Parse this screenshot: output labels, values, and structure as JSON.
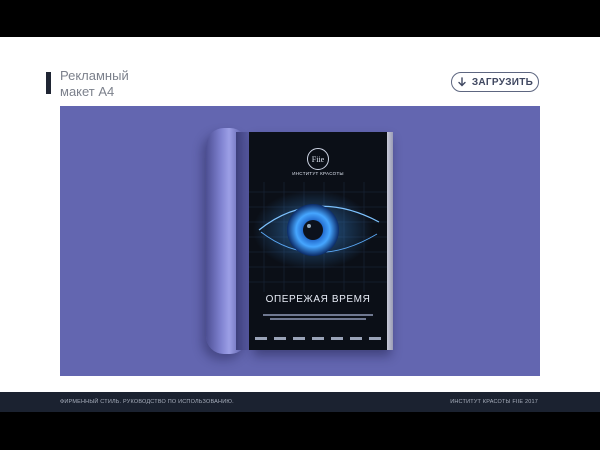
{
  "header": {
    "title": "Рекламный\nмакет А4",
    "download_label": "ЗАГРУЗИТЬ",
    "download_icon": "download-arrow-icon"
  },
  "colors": {
    "stage_background": "#6366b0",
    "footer_background": "#1b2230",
    "accent_dark": "#1f2533"
  },
  "poster": {
    "logo_text": "Fiie",
    "brand_subtitle": "ИНСТИТУТ КРАСОТЫ",
    "headline": "ОПЕРЕЖАЯ ВРЕМЯ"
  },
  "footer": {
    "left_text": "ФИРМЕННЫЙ СТИЛЬ. РУКОВОДСТВО ПО ИСПОЛЬЗОВАНИЮ.",
    "right_text": "ИНСТИТУТ КРАСОТЫ FIIE 2017"
  }
}
